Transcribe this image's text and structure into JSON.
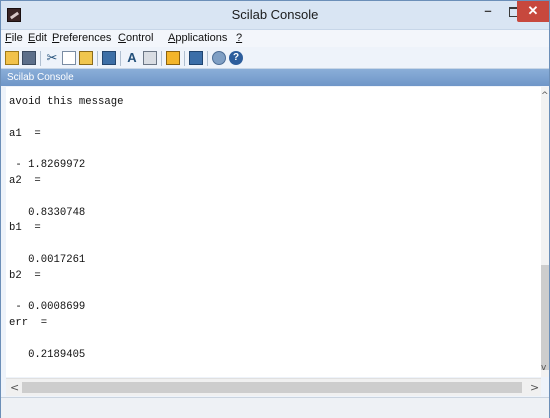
{
  "window": {
    "title": "Scilab Console",
    "controls": {
      "minimize": "–",
      "close": "✕"
    }
  },
  "menubar": [
    {
      "u": "F",
      "rest": "ile"
    },
    {
      "u": "E",
      "rest": "dit"
    },
    {
      "u": "P",
      "rest": "references"
    },
    {
      "u": "C",
      "rest": "ontrol"
    },
    {
      "u": "A",
      "rest": "pplications"
    },
    {
      "u": "?",
      "rest": ""
    }
  ],
  "toolbar": {
    "icons": [
      "new-script-icon",
      "open-file-icon",
      "cut-icon",
      "copy-icon",
      "paste-icon",
      "change-directory-icon",
      "font-icon",
      "print-icon",
      "variable-browser-icon",
      "scinotes-icon",
      "module-manager-icon",
      "help-icon"
    ]
  },
  "panel": {
    "header": "Scilab Console"
  },
  "console": {
    "text": "avoid this message\n\na1  =\n\n - 1.8269972\na2  =\n\n   0.8330748\nb1  =\n\n   0.0017261\nb2  =\n\n - 0.0008699\nerr  =\n\n   0.2189405"
  },
  "scrollbars": {
    "left": "<",
    "right": ">",
    "up": "^",
    "down": "v"
  },
  "colors": {
    "title_bar": "#d9e5f3",
    "panel_header": "#7ba2d1",
    "close_button": "#c7483d"
  }
}
